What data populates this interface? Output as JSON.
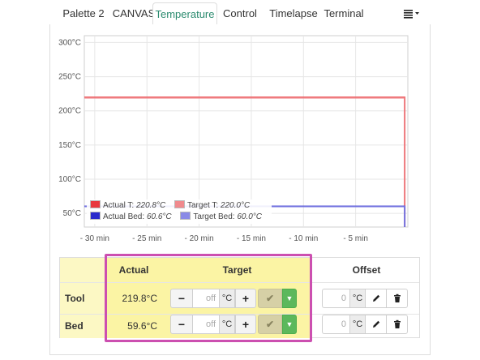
{
  "tabs": [
    {
      "label": "Palette 2",
      "active": false
    },
    {
      "label": "CANVAS",
      "active": false
    },
    {
      "label": "Temperature",
      "active": true
    },
    {
      "label": "Control",
      "active": false
    },
    {
      "label": "Timelapse",
      "active": false
    },
    {
      "label": "Terminal",
      "active": false
    }
  ],
  "menu_icon": "hamburger-dropdown-icon",
  "chart_data": {
    "type": "line",
    "y_ticks": [
      "50°C",
      "100°C",
      "150°C",
      "200°C",
      "250°C",
      "300°C"
    ],
    "y_tick_values": [
      50,
      100,
      150,
      200,
      250,
      300
    ],
    "ylim": [
      30,
      310
    ],
    "x_ticks": [
      "- 30 min",
      "- 25 min",
      "- 20 min",
      "- 15 min",
      "- 10 min",
      "- 5 min"
    ],
    "x_tick_values": [
      -30,
      -25,
      -20,
      -15,
      -10,
      -5
    ],
    "xlim": [
      -31,
      0
    ],
    "grid": true,
    "legend_position": "bottom-left",
    "series": [
      {
        "name": "Actual T:",
        "value_text": "220.8°C",
        "color": "#e8383d",
        "x": [
          -31,
          -0.3,
          -0.3
        ],
        "y": [
          220,
          220,
          0
        ]
      },
      {
        "name": "Target T:",
        "value_text": "220.0°C",
        "color": "#f08a8d",
        "x": [
          -31,
          -0.3,
          -0.3
        ],
        "y": [
          219,
          219,
          0
        ]
      },
      {
        "name": "Actual Bed:",
        "value_text": "60.6°C",
        "color": "#2b2bcc",
        "x": [
          -31,
          -0.3,
          -0.3
        ],
        "y": [
          60.5,
          60.5,
          0
        ]
      },
      {
        "name": "Target Bed:",
        "value_text": "60.0°C",
        "color": "#8a8ae6",
        "x": [
          -31,
          -0.3,
          -0.3
        ],
        "y": [
          60,
          60,
          0
        ]
      }
    ]
  },
  "controls": {
    "headers": {
      "actual": "Actual",
      "target": "Target",
      "offset": "Offset"
    },
    "rows": [
      {
        "label": "Tool",
        "actual": "219.8°C",
        "target_placeholder": "off",
        "unit": "°C",
        "offset_value": "0",
        "offset_unit": "°C"
      },
      {
        "label": "Bed",
        "actual": "59.6°C",
        "target_placeholder": "off",
        "unit": "°C",
        "offset_value": "0",
        "offset_unit": "°C"
      }
    ],
    "buttons": {
      "minus": "−",
      "plus": "+",
      "ok": "✔",
      "dropdown": "▼"
    }
  },
  "colors": {
    "accent": "#2a8a6e",
    "highlight_border": "#cc4fb0",
    "highlight_fill": "#fbf4a4",
    "success": "#5cb85c"
  }
}
